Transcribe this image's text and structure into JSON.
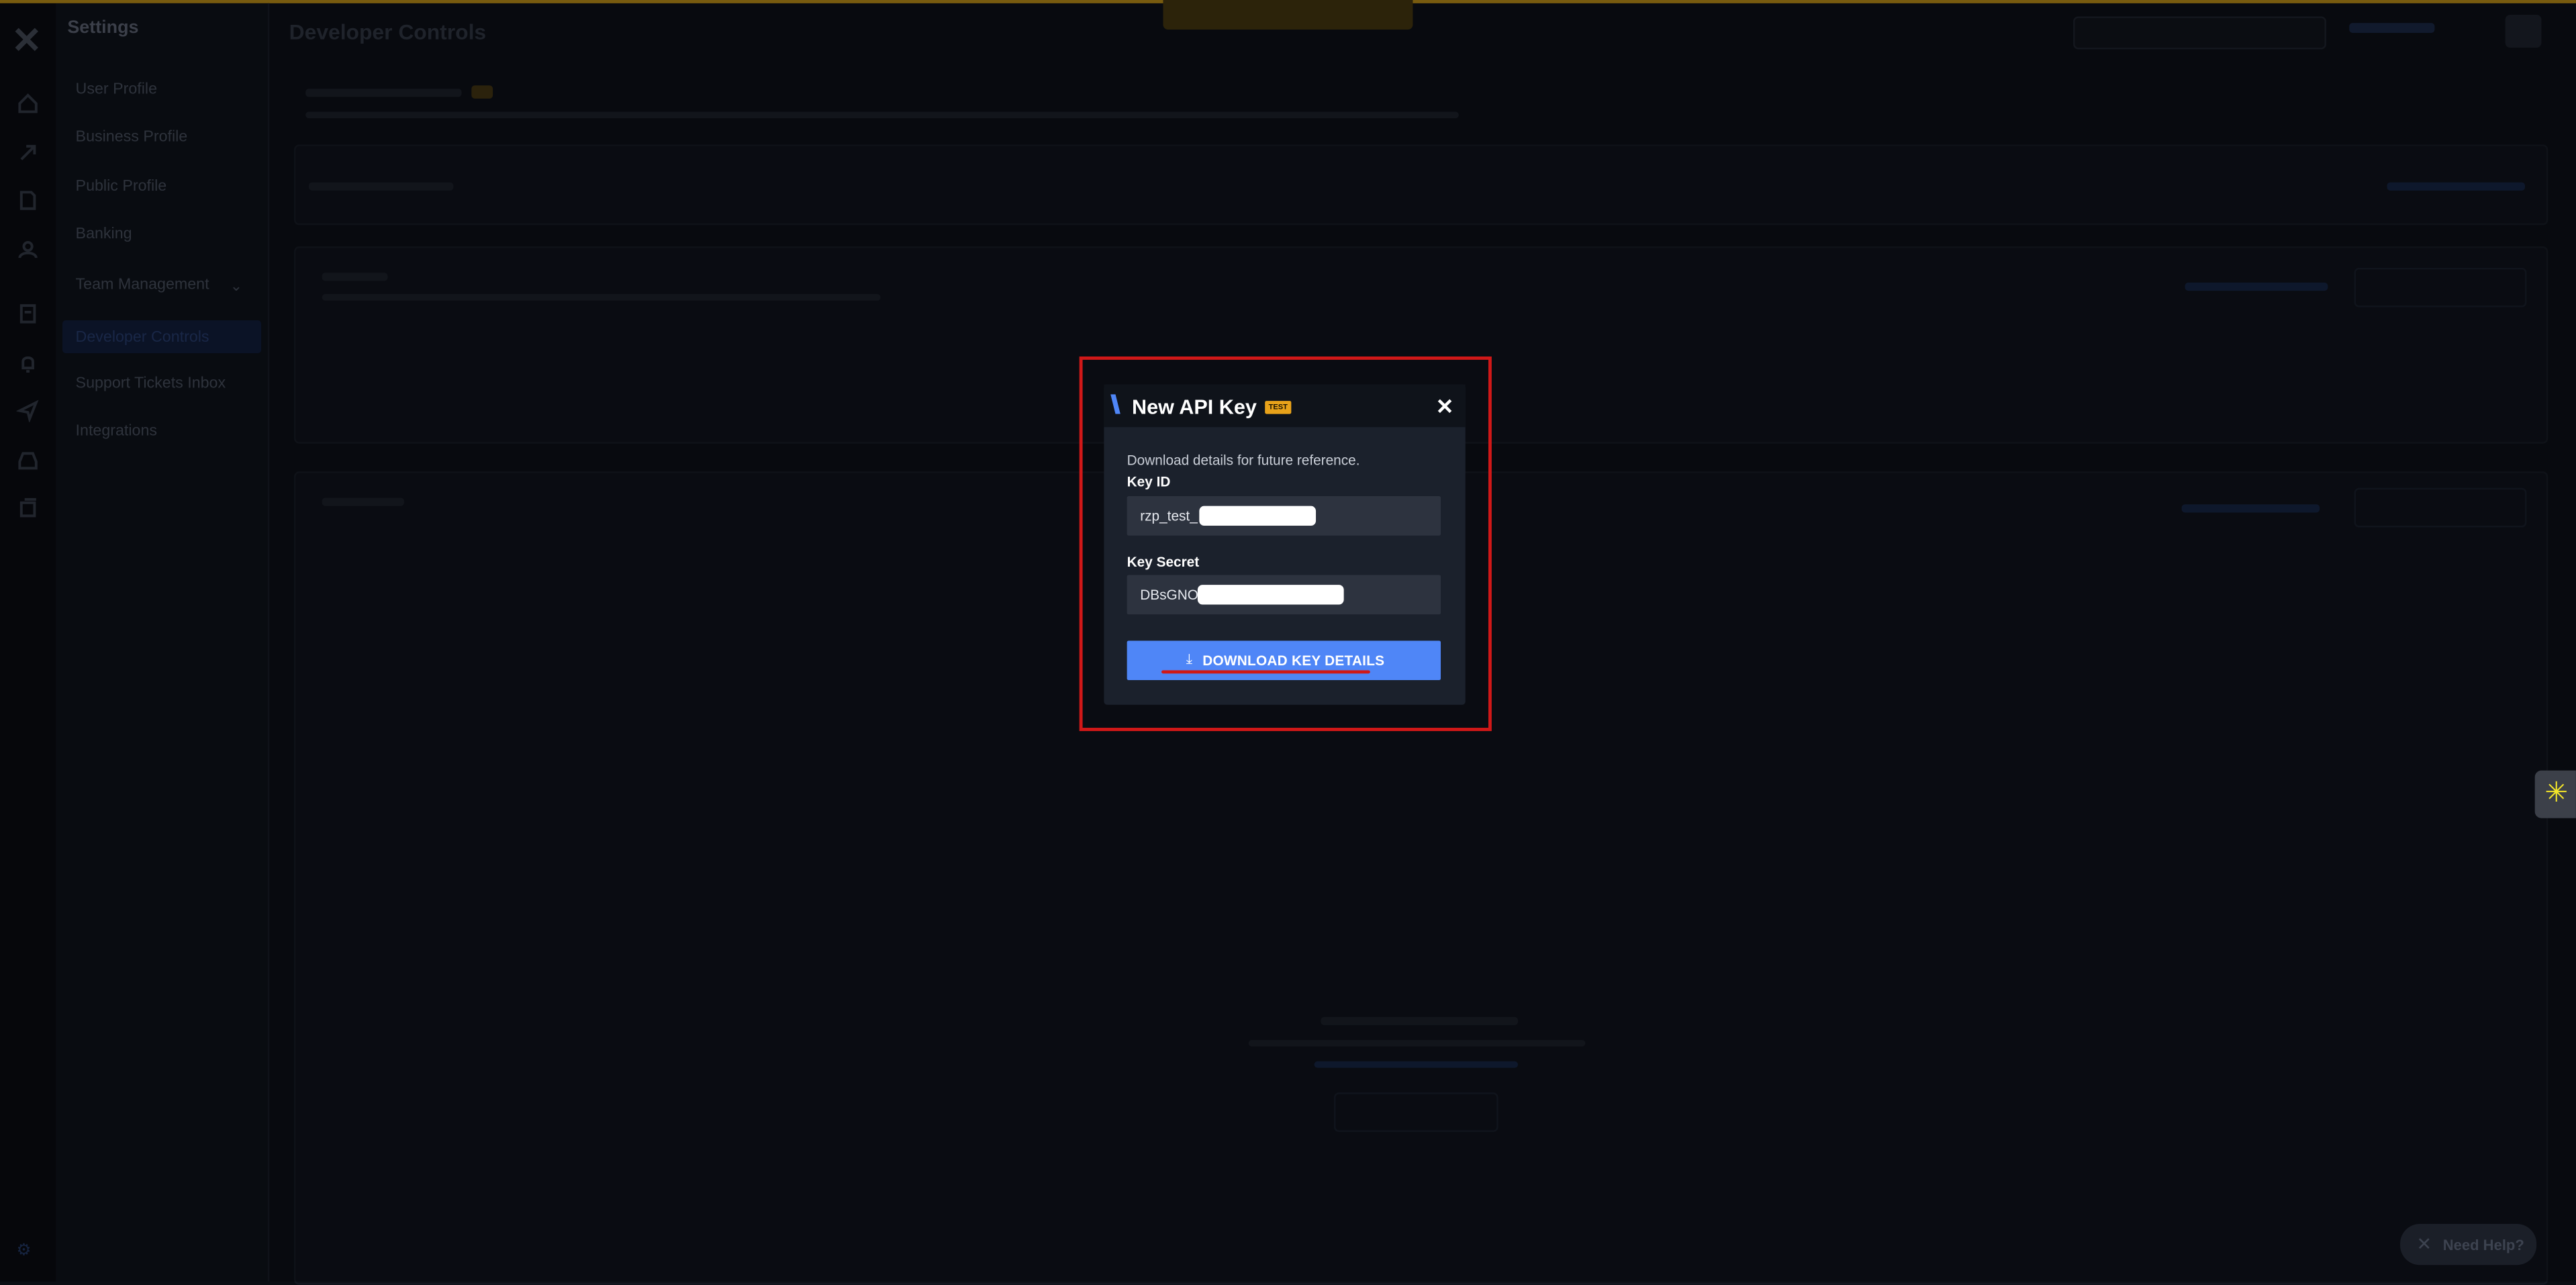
{
  "app": {
    "section": "Settings",
    "page_title": "Developer Controls"
  },
  "sidebar": {
    "title": "Settings",
    "items": [
      {
        "label": "User Profile"
      },
      {
        "label": "Business Profile"
      },
      {
        "label": "Public Profile"
      },
      {
        "label": "Banking"
      },
      {
        "label": "Team Management"
      },
      {
        "label": "Developer Controls"
      },
      {
        "label": "Support Tickets Inbox"
      },
      {
        "label": "Integrations"
      }
    ]
  },
  "modal": {
    "title": "New API Key",
    "badge": "TEST",
    "description": "Download details for future reference.",
    "key_id_label": "Key ID",
    "key_id_value": "rzp_test_",
    "key_secret_label": "Key Secret",
    "key_secret_value": "DBsGNO",
    "download_label": "DOWNLOAD KEY DETAILS",
    "close_glyph": "✕",
    "download_glyph": "⤓"
  },
  "widgets": {
    "need_help_label": "Need Help?"
  },
  "colors": {
    "accent": "#4f86f7",
    "badge": "#e8a21a",
    "highlight": "#d01818",
    "modal_bg": "#1b212c"
  }
}
